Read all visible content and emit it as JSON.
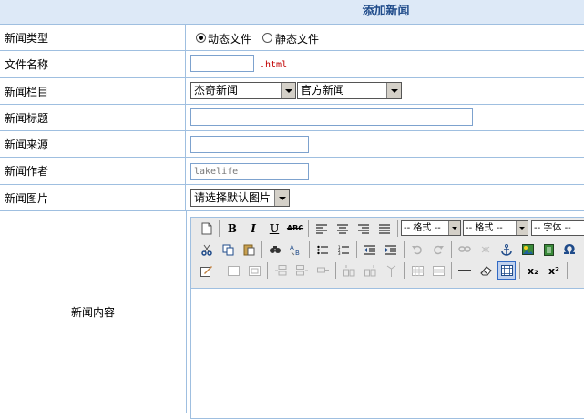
{
  "header": {
    "title": "添加新闻"
  },
  "rows": {
    "type": {
      "label": "新闻类型",
      "options": [
        "动态文件",
        "静态文件"
      ],
      "selected_option": "动态文件"
    },
    "filename": {
      "label": "文件名称",
      "value": "",
      "extension": ".html"
    },
    "column": {
      "label": "新闻栏目",
      "select1": "杰奇新闻",
      "select2": "官方新闻"
    },
    "title": {
      "label": "新闻标题",
      "value": ""
    },
    "source": {
      "label": "新闻来源",
      "value": ""
    },
    "author": {
      "label": "新闻作者",
      "value": "lakelife"
    },
    "image": {
      "label": "新闻图片",
      "select": "请选择默认图片"
    },
    "content": {
      "label": "新闻内容"
    }
  },
  "editor": {
    "format_select_1": "-- 格式 --",
    "format_select_2": "-- 格式 --",
    "font_select": "-- 字体 --",
    "text_buttons": {
      "bold": "B",
      "italic": "I",
      "underline": "U",
      "strike": "ABC",
      "sub": "x₂",
      "sup": "x²",
      "omega": "Ω"
    },
    "icons": [
      "new-document-icon",
      "bold-icon",
      "italic-icon",
      "underline-icon",
      "strikethrough-icon",
      "align-left-icon",
      "align-center-icon",
      "align-right-icon",
      "align-justify-icon",
      "cut-icon",
      "copy-icon",
      "paste-icon",
      "find-icon",
      "replace-icon",
      "ordered-list-icon",
      "unordered-list-icon",
      "outdent-icon",
      "indent-icon",
      "undo-icon",
      "redo-icon",
      "link-icon",
      "unlink-icon",
      "anchor-icon",
      "image-icon",
      "media-icon",
      "special-char-icon",
      "edit-source-icon",
      "table-row-icon",
      "table-col-icon",
      "insert-row-before-icon",
      "insert-row-after-icon",
      "delete-row-icon",
      "insert-col-before-icon",
      "insert-col-after-icon",
      "delete-col-icon",
      "merge-cells-icon",
      "split-cells-icon",
      "horizontal-rule-icon",
      "eraser-icon",
      "table-icon",
      "subscript-icon",
      "superscript-icon"
    ]
  }
}
